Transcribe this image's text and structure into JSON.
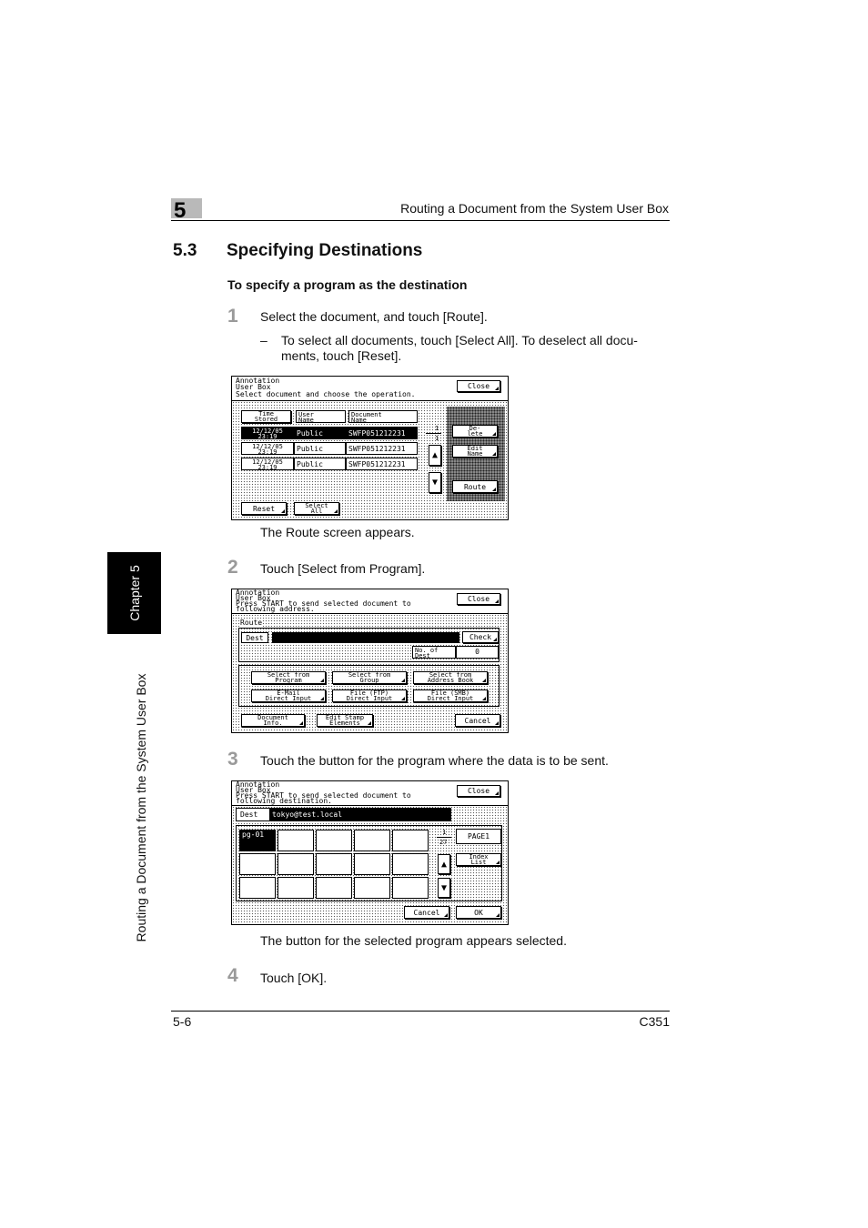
{
  "header": {
    "chapter_number": "5",
    "running_title": "Routing a Document from the System User Box"
  },
  "section": {
    "number": "5.3",
    "title": "Specifying Destinations"
  },
  "subheading": "To specify a program as the destination",
  "steps": [
    {
      "num": "1",
      "text": "Select the document, and touch [Route].",
      "bullet": "–",
      "sub1": "To select all documents, touch [Select All]. To deselect all docu-",
      "sub2": "ments, touch [Reset].",
      "after": "The Route screen appears."
    },
    {
      "num": "2",
      "text": "Touch [Select from Program]."
    },
    {
      "num": "3",
      "text": "Touch the button for the program where the data is to be sent.",
      "after": "The button for the selected program appears selected."
    },
    {
      "num": "4",
      "text": "Touch [OK]."
    }
  ],
  "side": {
    "tab": "Chapter 5",
    "text": "Routing a Document from the System User Box"
  },
  "footer": {
    "page": "5-6",
    "model": "C351"
  },
  "screen1": {
    "line1": "Annotation",
    "line2": "User Box",
    "line3": "Select document and choose the operation.",
    "close": "Close",
    "col1a": "Time",
    "col1b": "Stored",
    "col2a": "User",
    "col2b": "Name",
    "col3a": "Document",
    "col3b": "Name",
    "rows": [
      {
        "d1": "12/12/05",
        "d2": "23:19",
        "user": "Public",
        "doc": "SWFP051212231"
      },
      {
        "d1": "12/12/05",
        "d2": "23:19",
        "user": "Public",
        "doc": "SWFP051212231"
      },
      {
        "d1": "12/12/05",
        "d2": "23:19",
        "user": "Public",
        "doc": "SWFP051212231"
      }
    ],
    "page_num": "1",
    "page_den": "1",
    "delete_a": "De-",
    "delete_b": "lete",
    "edit_a": "Edit",
    "edit_b": "Name",
    "route": "Route",
    "reset": "Reset",
    "selall_a": "Select",
    "selall_b": "All"
  },
  "screen2": {
    "line1": "Annotation",
    "line2": "User Box",
    "line3": "Press START to send selected document to",
    "line4": "following address.",
    "close": "Close",
    "route_label": "Route",
    "dest": "Dest",
    "check": "Check",
    "nodest_a": "No. of",
    "nodest_b": "Dest",
    "nodest_val": "0",
    "b1a": "Select from",
    "b1b": "Program",
    "b2a": "Select from",
    "b2b": "Group",
    "b3a": "Select from",
    "b3b": "Address Book",
    "b4a": "E-Mail",
    "b4b": "Direct Input",
    "b5a": "File (FTP)",
    "b5b": "Direct Input",
    "b6a": "File (SMB)",
    "b6b": "Direct Input",
    "docinfo_a": "Document",
    "docinfo_b": "Info.",
    "editstamp_a": "Edit Stamp",
    "editstamp_b": "Elements",
    "cancel": "Cancel"
  },
  "screen3": {
    "line1": "Annotation",
    "line2": "User Box",
    "line3": "Press START to send selected document to",
    "line4": "following destination.",
    "close": "Close",
    "dest": "Dest",
    "dest_value": "tokyo@test.local",
    "selected_prog": "pg-01",
    "page_num": "1",
    "page_den": "27",
    "page_label": "PAGE1",
    "index_a": "Index",
    "index_b": "List",
    "cancel": "Cancel",
    "ok": "OK"
  }
}
